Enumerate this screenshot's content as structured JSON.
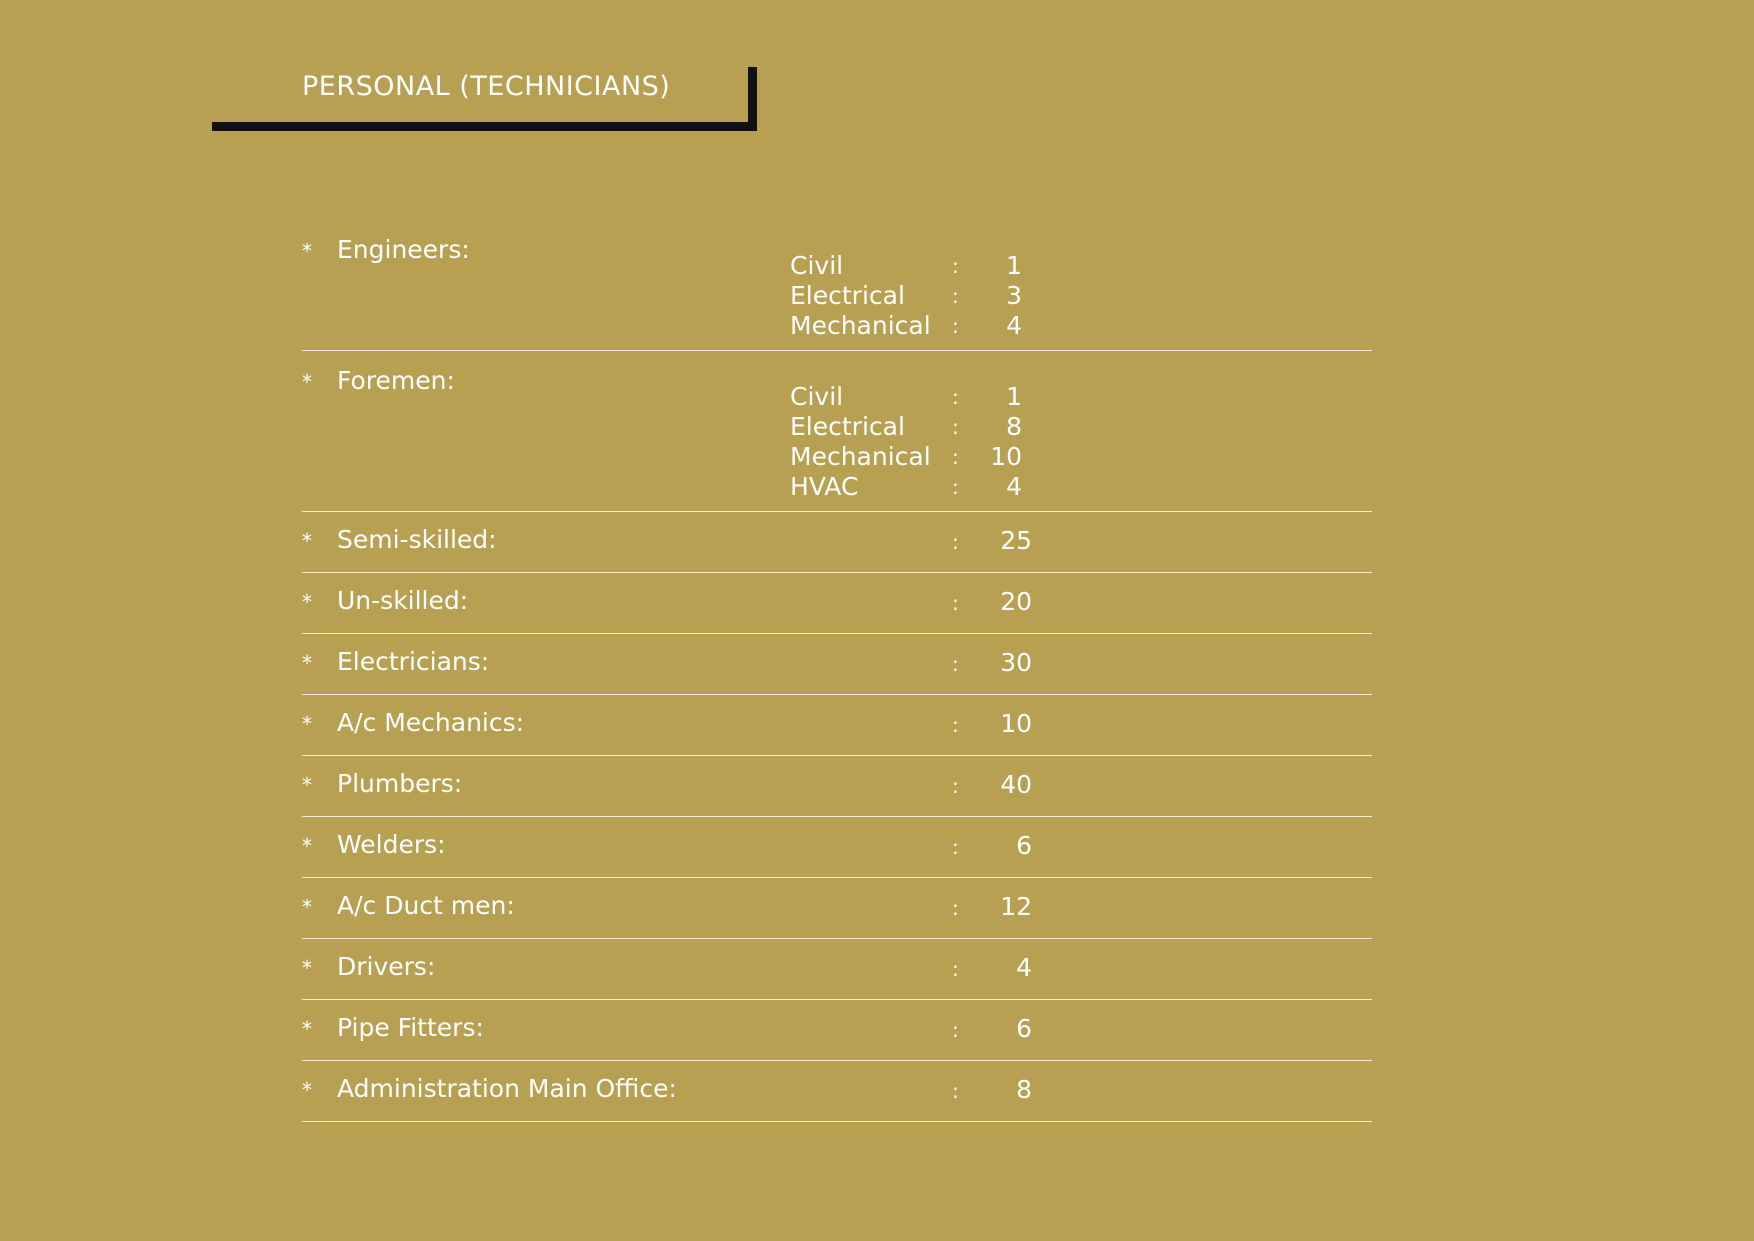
{
  "page": {
    "title": "PERSONAL (TECHNICIANS)"
  },
  "colors": {
    "background": "#b8a052",
    "text": "#ffffff",
    "title_border": "#111111"
  },
  "categories": [
    {
      "bullet": "*",
      "label": "Engineers:",
      "subcategories": [
        {
          "label": "Civil",
          "colon": ":",
          "value": "1"
        },
        {
          "label": "Electrical",
          "colon": ":",
          "value": "3"
        },
        {
          "label": "Mechanical",
          "colon": ":",
          "value": "4"
        }
      ]
    },
    {
      "bullet": "*",
      "label": "Foremen:",
      "subcategories": [
        {
          "label": "Civil",
          "colon": ":",
          "value": "1"
        },
        {
          "label": "Electrical",
          "colon": ":",
          "value": "8"
        },
        {
          "label": "Mechanical",
          "colon": ":",
          "value": "10"
        },
        {
          "label": "HVAC",
          "colon": ":",
          "value": "4"
        }
      ]
    },
    {
      "bullet": "*",
      "label": "Semi-skilled:",
      "colon": ":",
      "value": "25"
    },
    {
      "bullet": "*",
      "label": "Un-skilled:",
      "colon": ":",
      "value": "20"
    },
    {
      "bullet": "*",
      "label": "Electricians:",
      "colon": ":",
      "value": "30"
    },
    {
      "bullet": "*",
      "label": "A/c Mechanics:",
      "colon": ":",
      "value": "10"
    },
    {
      "bullet": "*",
      "label": "Plumbers:",
      "colon": ":",
      "value": "40"
    },
    {
      "bullet": "*",
      "label": "Welders:",
      "colon": ":",
      "value": "6"
    },
    {
      "bullet": "*",
      "label": "A/c Duct men:",
      "colon": ":",
      "value": "12"
    },
    {
      "bullet": "*",
      "label": "Drivers:",
      "colon": ":",
      "value": "4"
    },
    {
      "bullet": "*",
      "label": "Pipe Fitters:",
      "colon": ":",
      "value": "6"
    },
    {
      "bullet": "*",
      "label": "Administration Main Office:",
      "colon": ":",
      "value": "8"
    }
  ]
}
